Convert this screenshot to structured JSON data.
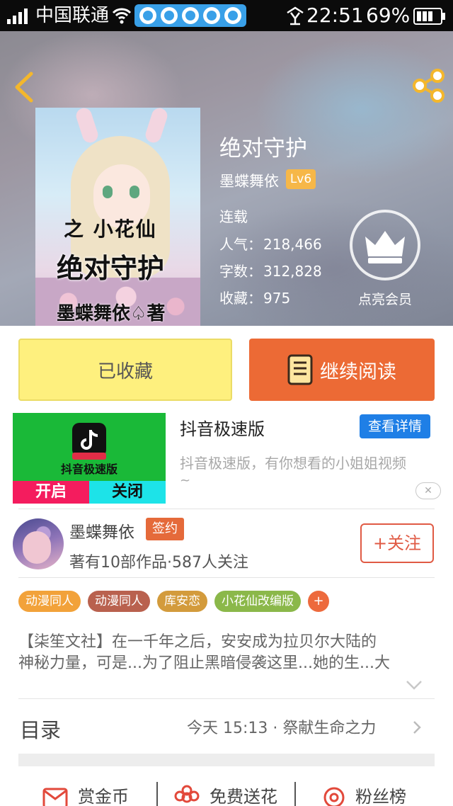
{
  "status_bar": {
    "carrier": "中国联通",
    "time": "22:51",
    "battery_pct": "69%"
  },
  "header": {
    "back_icon": "chevron-left-icon",
    "share_icon": "share-icon"
  },
  "book": {
    "title": "绝对守护",
    "author": "墨蝶舞依",
    "level": "Lv6",
    "serial_status": "连载",
    "cover": {
      "subtitle": "小花仙",
      "subtitle_mark": "之",
      "main_title": "绝对守护",
      "author_line": "墨蝶舞依",
      "author_suffix": "著"
    },
    "stats": [
      {
        "label": "人气：",
        "value": "218,466"
      },
      {
        "label": "字数：",
        "value": "312,828"
      },
      {
        "label": "收藏：",
        "value": "975"
      }
    ],
    "vip_label": "点亮会员"
  },
  "actions": {
    "collected_label": "已收藏",
    "continue_label": "继续阅读"
  },
  "ad": {
    "image_title": "抖音极速版",
    "image_open": "开启",
    "image_close": "关闭",
    "title": "抖音极速版",
    "detail_label": "查看详情",
    "description": "抖音极速版，有你想看的小姐姐视频",
    "description_tail": "~"
  },
  "author_row": {
    "name": "墨蝶舞依",
    "sign_badge": "签约",
    "meta": "著有10部作品·587人关注",
    "follow_label": "+关注"
  },
  "tags": [
    {
      "label": "动漫同人",
      "color": "#f2a23a"
    },
    {
      "label": "动漫同人",
      "color": "#b9614e"
    },
    {
      "label": "库安恋",
      "color": "#d39b3c"
    },
    {
      "label": "小花仙改编版",
      "color": "#8bb84a"
    }
  ],
  "tag_more": "+",
  "intro": {
    "line1": "【柒笙文社】在一千年之后，安安成为拉贝尔大陆的",
    "line2": "神秘力量，可是...为了阻止黑暗侵袭这里...她的生...大"
  },
  "toc": {
    "label": "目录",
    "latest": "今天 15:13 · 祭献生命之力"
  },
  "bottom": {
    "reward": "赏金币",
    "flowers": "免费送花",
    "fans": "粉丝榜"
  },
  "colors": {
    "accent_orange": "#ec6a35",
    "collected_yellow": "#fef07e",
    "detail_blue": "#1f7fe6",
    "level_gold": "#f6b748"
  }
}
